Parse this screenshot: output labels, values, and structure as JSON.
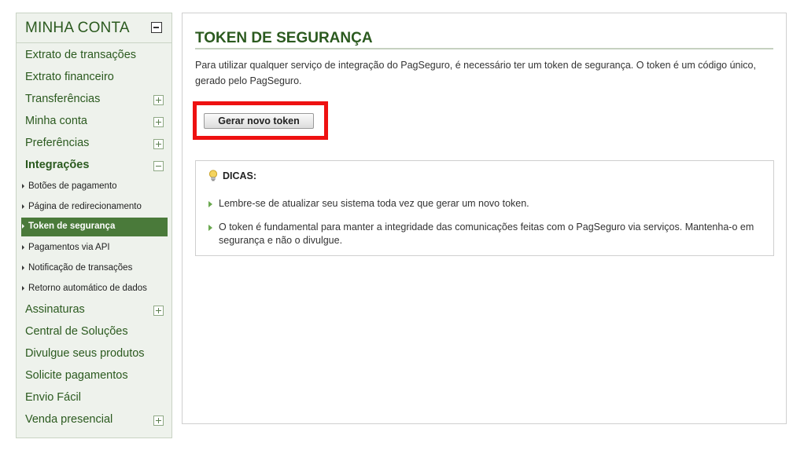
{
  "sidebar": {
    "title": "MINHA CONTA",
    "items": [
      {
        "label": "Extrato de transações"
      },
      {
        "label": "Extrato financeiro"
      },
      {
        "label": "Transferências",
        "toggle": "plus"
      },
      {
        "label": "Minha conta",
        "toggle": "plus"
      },
      {
        "label": "Preferências",
        "toggle": "plus"
      },
      {
        "label": "Integrações",
        "toggle": "minus",
        "expanded": true
      }
    ],
    "subitems": [
      {
        "label": "Botões de pagamento"
      },
      {
        "label": "Página de redirecionamento"
      },
      {
        "label": "Token de segurança",
        "active": true
      },
      {
        "label": "Pagamentos via API"
      },
      {
        "label": "Notificação de transações"
      },
      {
        "label": "Retorno automático de dados"
      }
    ],
    "items_after": [
      {
        "label": "Assinaturas",
        "toggle": "plus"
      },
      {
        "label": "Central de Soluções"
      },
      {
        "label": "Divulgue seus produtos"
      },
      {
        "label": "Solicite pagamentos"
      },
      {
        "label": "Envio Fácil"
      },
      {
        "label": "Venda presencial",
        "toggle": "plus"
      }
    ]
  },
  "content": {
    "title": "TOKEN DE SEGURANÇA",
    "intro": "Para utilizar qualquer serviço de integração do PagSeguro, é necessário ter um token de segurança. O token é um código único, gerado pelo PagSeguro.",
    "button_label": "Gerar novo token",
    "highlight_color": "#ee1111",
    "tips": {
      "title": "DICAS:",
      "icon": "lightbulb-icon",
      "items": [
        "Lembre-se de atualizar seu sistema toda vez que gerar um novo token.",
        "O token é fundamental para manter a integridade das comunicações feitas com o PagSeguro via serviços. Mantenha-o em segurança e não o divulgue."
      ]
    }
  },
  "colors": {
    "brand_green": "#2b5a1f",
    "active_bg": "#4a7a3a",
    "sidebar_bg": "#eef2ec"
  }
}
